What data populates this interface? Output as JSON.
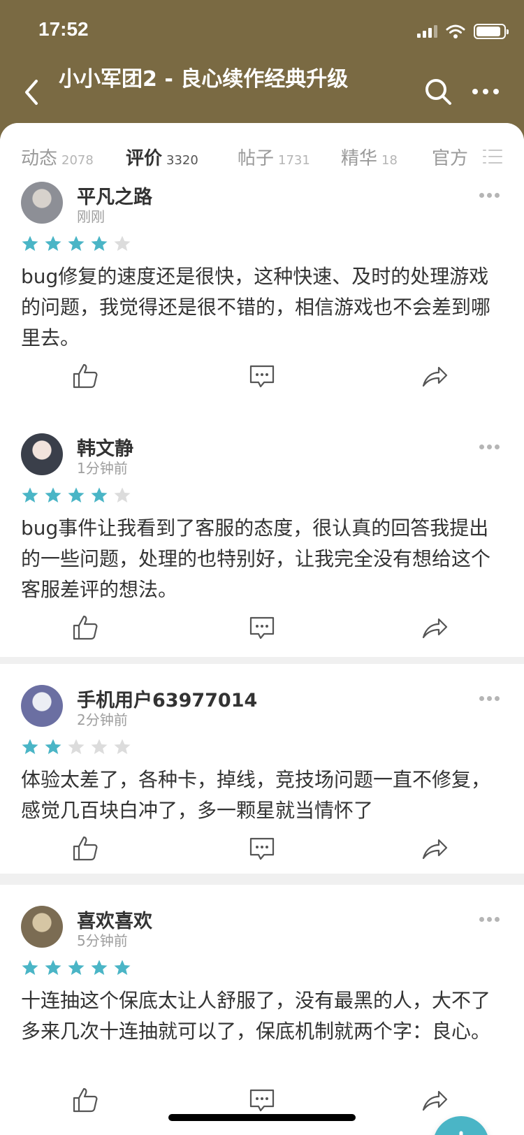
{
  "status_bar": {
    "time": "17:52"
  },
  "nav": {
    "title": "小小军团2 - 良心续作经典升级"
  },
  "tabs": [
    {
      "label": "动态",
      "count": "2078"
    },
    {
      "label": "评价",
      "count": "3320"
    },
    {
      "label": "帖子",
      "count": "1731"
    },
    {
      "label": "精华",
      "count": "18"
    },
    {
      "label": "官方",
      "count": ""
    }
  ],
  "active_tab_index": 1,
  "colors": {
    "header_bg": "#7a6a43",
    "accent": "#4ab5c6",
    "star_empty": "#dcdcdc"
  },
  "reviews": [
    {
      "user": "平凡之路",
      "time": "刚刚",
      "rating": 4,
      "text": "bug修复的速度还是很快，这种快速、及时的处理游戏的问题，我觉得还是很不错的，相信游戏也不会差到哪里去。"
    },
    {
      "user": "韩文静",
      "time": "1分钟前",
      "rating": 4,
      "text": "bug事件让我看到了客服的态度，很认真的回答我提出的一些问题，处理的也特别好，让我完全没有想给这个客服差评的想法。"
    },
    {
      "user": "手机用户63977014",
      "time": "2分钟前",
      "rating": 2,
      "text": "体验太差了，各种卡，掉线，竞技场问题一直不修复，感觉几百块白冲了，多一颗星就当情怀了"
    },
    {
      "user": "喜欢喜欢",
      "time": "5分钟前",
      "rating": 5,
      "text": "十连抽这个保底太让人舒服了，没有最黑的人，大不了多来几次十连抽就可以了，保底机制就两个字：良心。"
    }
  ]
}
